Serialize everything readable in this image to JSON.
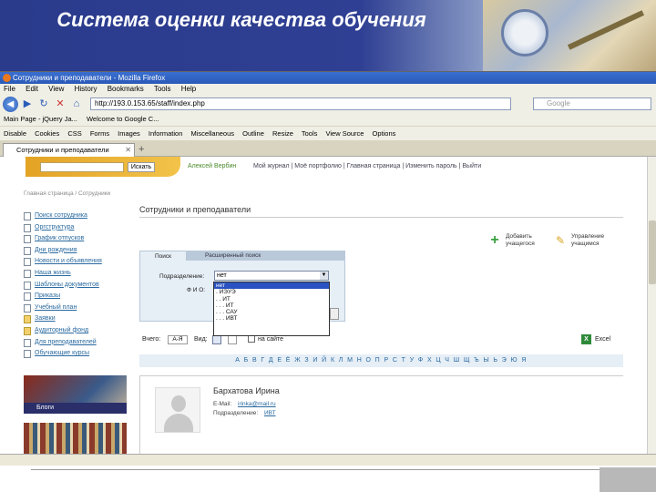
{
  "slide": {
    "title": "Система оценки качества обучения"
  },
  "browser": {
    "window_title": "Сотрудники и преподаватели - Mozilla Firefox",
    "menu": [
      "File",
      "Edit",
      "View",
      "History",
      "Bookmarks",
      "Tools",
      "Help"
    ],
    "url": "http://193.0.153.65/staff/index.php",
    "search_placeholder": "Google",
    "bookmarks": [
      "Main Page - jQuery Ja...",
      "Welcome to Google C..."
    ],
    "webdev_items": [
      "Disable",
      "Cookies",
      "CSS",
      "Forms",
      "Images",
      "Information",
      "Miscellaneous",
      "Outline",
      "Resize",
      "Tools",
      "View Source",
      "Options"
    ],
    "tab_label": "Сотрудники и преподаватели"
  },
  "site": {
    "search_button": "Искать",
    "user_name": "Алексей Вербин",
    "top_menu": "Мой журнал | Моё портфолио | Главная страница | Изменить пароль | Выйти",
    "breadcrumb": "Главная страница / Сотрудники",
    "nav": [
      {
        "label": "Поиск сотрудника",
        "icon": "page-icon"
      },
      {
        "label": "Оргструктура",
        "icon": "page-icon"
      },
      {
        "label": "График отпусков",
        "icon": "page-icon"
      },
      {
        "label": "Дни рождения",
        "icon": "page-icon"
      },
      {
        "label": "Новости и объявления",
        "icon": "page-icon"
      },
      {
        "label": "Наша жизнь",
        "icon": "page-icon"
      },
      {
        "label": "Шаблоны документов",
        "icon": "page-icon"
      },
      {
        "label": "Приказы",
        "icon": "page-icon"
      },
      {
        "label": "Учебный план",
        "icon": "page-icon"
      },
      {
        "label": "Заявки",
        "icon": "folder-icon"
      },
      {
        "label": "Аудиторный фонд",
        "icon": "folder-icon"
      },
      {
        "label": "Для преподавателей",
        "icon": "page-icon"
      },
      {
        "label": "Обучающие курсы",
        "icon": "page-icon"
      }
    ],
    "promo_label": "Блоги"
  },
  "content": {
    "title": "Сотрудники и преподаватели",
    "add_action": "Добавить учащегося",
    "manage_action": "Управление учащимся",
    "tabs": [
      "Поиск",
      "Расширенный поиск"
    ],
    "department_label": "Подразделение:",
    "fio_label": "Ф И О:",
    "department_value": "нет",
    "department_options": [
      "нет",
      ". ИЭУЭ",
      ". . ИТ",
      ". . . ИТ",
      ". . . САУ",
      ". . . ИВТ"
    ],
    "view_label": "Вчего:",
    "view_button": "А-Я",
    "view2_label": "Вид:",
    "onsite_label": "на сайте",
    "excel_label": "Excel",
    "alphabet": "А Б В Г Д Е Ё Ж З И Й К Л М Н О П Р С Т У Ф Х Ц Ч Ш Щ Ъ Ы Ь Э Ю Я"
  },
  "person": {
    "name": "Бархатова Ирина",
    "email_label": "E-Mail:",
    "email": "irinka@mail.ru",
    "dept_label": "Подразделение:",
    "dept": "ИВТ"
  }
}
